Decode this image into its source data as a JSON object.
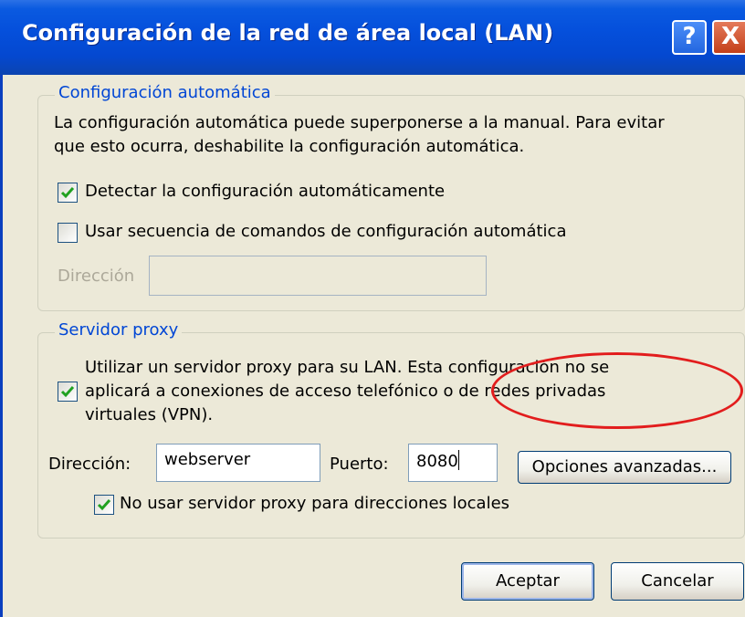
{
  "window": {
    "title": "Configuración de la red de área local (LAN)",
    "help_glyph": "?",
    "close_glyph": "X"
  },
  "auto_config": {
    "legend": "Configuración automática",
    "description_line1": "La configuración automática puede superponerse a la manual. Para evitar",
    "description_line2": "que esto ocurra, deshabilite la configuración automática.",
    "detect_label": "Detectar la configuración automáticamente",
    "detect_checked": true,
    "script_label": "Usar secuencia de comandos de configuración automática",
    "script_checked": false,
    "address_label": "Dirección",
    "address_value": ""
  },
  "proxy": {
    "legend": "Servidor proxy",
    "use_proxy_line1": "Utilizar un servidor proxy para su LAN. Esta configuración no se",
    "use_proxy_line2": "aplicará a conexiones de acceso telefónico o de redes privadas",
    "use_proxy_line3": "virtuales (VPN).",
    "use_proxy_checked": true,
    "address_label": "Dirección:",
    "address_value": "webserver",
    "port_label": "Puerto:",
    "port_value": "8080",
    "advanced_button": "Opciones avanzadas...",
    "bypass_label": "No usar servidor proxy para direcciones locales",
    "bypass_checked": true
  },
  "buttons": {
    "ok": "Aceptar",
    "cancel": "Cancelar"
  },
  "colors": {
    "title_bar": "#0550dc",
    "legend_text": "#0046d5",
    "highlight": "#e21d1d",
    "dialog_bg": "#ece9d8"
  }
}
